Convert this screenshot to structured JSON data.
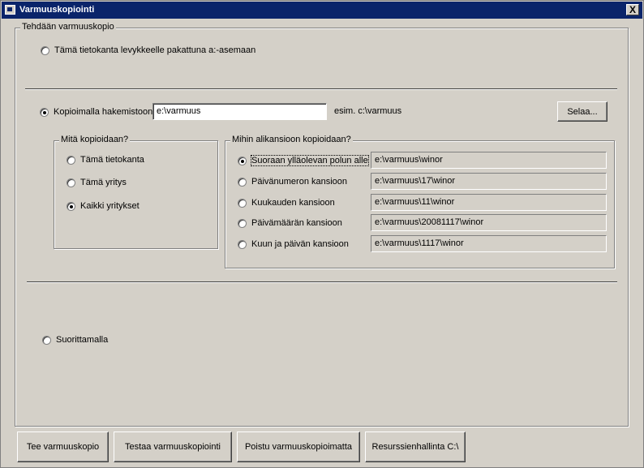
{
  "window": {
    "title": "Varmuuskopiointi",
    "close_label": "X"
  },
  "main_group": {
    "legend": "Tehdään varmuuskopio"
  },
  "options": {
    "floppy": "Tämä tietokanta levykkeelle pakattuna a:-asemaan",
    "copy_dir": "Kopioimalla hakemistoon",
    "run": "Suorittamalla"
  },
  "path": {
    "value": "e:\\varmuus",
    "example": "esim. c:\\varmuus",
    "browse_label": "Selaa..."
  },
  "what_group": {
    "legend": "Mitä kopioidaan?",
    "items": [
      "Tämä tietokanta",
      "Tämä yritys",
      "Kaikki yritykset"
    ],
    "selected": 2
  },
  "where_group": {
    "legend": "Mihin alikansioon kopioidaan?",
    "items": [
      {
        "label": "Suoraan ylläolevan polun alle",
        "path": "e:\\varmuus\\winor"
      },
      {
        "label": "Päivänumeron kansioon",
        "path": "e:\\varmuus\\17\\winor"
      },
      {
        "label": "Kuukauden kansioon",
        "path": "e:\\varmuus\\11\\winor"
      },
      {
        "label": "Päivämäärän kansioon",
        "path": "e:\\varmuus\\20081117\\winor"
      },
      {
        "label": "Kuun ja päivän kansioon",
        "path": "e:\\varmuus\\1117\\winor"
      }
    ],
    "selected": 0
  },
  "buttons": {
    "make": "Tee varmuuskopio",
    "test": "Testaa varmuuskopiointi",
    "exit": "Poistu varmuuskopioimatta",
    "explorer": "Resurssienhallinta C:\\"
  }
}
